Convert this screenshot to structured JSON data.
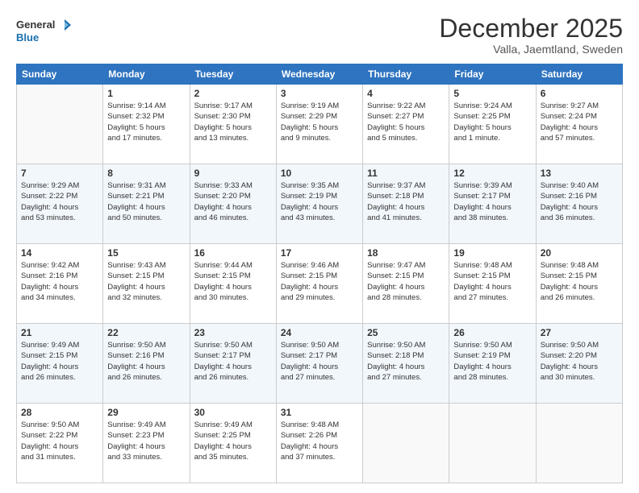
{
  "logo": {
    "line1": "General",
    "line2": "Blue"
  },
  "title": "December 2025",
  "subtitle": "Valla, Jaemtland, Sweden",
  "days_header": [
    "Sunday",
    "Monday",
    "Tuesday",
    "Wednesday",
    "Thursday",
    "Friday",
    "Saturday"
  ],
  "weeks": [
    [
      {
        "num": "",
        "info": ""
      },
      {
        "num": "1",
        "info": "Sunrise: 9:14 AM\nSunset: 2:32 PM\nDaylight: 5 hours\nand 17 minutes."
      },
      {
        "num": "2",
        "info": "Sunrise: 9:17 AM\nSunset: 2:30 PM\nDaylight: 5 hours\nand 13 minutes."
      },
      {
        "num": "3",
        "info": "Sunrise: 9:19 AM\nSunset: 2:29 PM\nDaylight: 5 hours\nand 9 minutes."
      },
      {
        "num": "4",
        "info": "Sunrise: 9:22 AM\nSunset: 2:27 PM\nDaylight: 5 hours\nand 5 minutes."
      },
      {
        "num": "5",
        "info": "Sunrise: 9:24 AM\nSunset: 2:25 PM\nDaylight: 5 hours\nand 1 minute."
      },
      {
        "num": "6",
        "info": "Sunrise: 9:27 AM\nSunset: 2:24 PM\nDaylight: 4 hours\nand 57 minutes."
      }
    ],
    [
      {
        "num": "7",
        "info": "Sunrise: 9:29 AM\nSunset: 2:22 PM\nDaylight: 4 hours\nand 53 minutes."
      },
      {
        "num": "8",
        "info": "Sunrise: 9:31 AM\nSunset: 2:21 PM\nDaylight: 4 hours\nand 50 minutes."
      },
      {
        "num": "9",
        "info": "Sunrise: 9:33 AM\nSunset: 2:20 PM\nDaylight: 4 hours\nand 46 minutes."
      },
      {
        "num": "10",
        "info": "Sunrise: 9:35 AM\nSunset: 2:19 PM\nDaylight: 4 hours\nand 43 minutes."
      },
      {
        "num": "11",
        "info": "Sunrise: 9:37 AM\nSunset: 2:18 PM\nDaylight: 4 hours\nand 41 minutes."
      },
      {
        "num": "12",
        "info": "Sunrise: 9:39 AM\nSunset: 2:17 PM\nDaylight: 4 hours\nand 38 minutes."
      },
      {
        "num": "13",
        "info": "Sunrise: 9:40 AM\nSunset: 2:16 PM\nDaylight: 4 hours\nand 36 minutes."
      }
    ],
    [
      {
        "num": "14",
        "info": "Sunrise: 9:42 AM\nSunset: 2:16 PM\nDaylight: 4 hours\nand 34 minutes."
      },
      {
        "num": "15",
        "info": "Sunrise: 9:43 AM\nSunset: 2:15 PM\nDaylight: 4 hours\nand 32 minutes."
      },
      {
        "num": "16",
        "info": "Sunrise: 9:44 AM\nSunset: 2:15 PM\nDaylight: 4 hours\nand 30 minutes."
      },
      {
        "num": "17",
        "info": "Sunrise: 9:46 AM\nSunset: 2:15 PM\nDaylight: 4 hours\nand 29 minutes."
      },
      {
        "num": "18",
        "info": "Sunrise: 9:47 AM\nSunset: 2:15 PM\nDaylight: 4 hours\nand 28 minutes."
      },
      {
        "num": "19",
        "info": "Sunrise: 9:48 AM\nSunset: 2:15 PM\nDaylight: 4 hours\nand 27 minutes."
      },
      {
        "num": "20",
        "info": "Sunrise: 9:48 AM\nSunset: 2:15 PM\nDaylight: 4 hours\nand 26 minutes."
      }
    ],
    [
      {
        "num": "21",
        "info": "Sunrise: 9:49 AM\nSunset: 2:15 PM\nDaylight: 4 hours\nand 26 minutes."
      },
      {
        "num": "22",
        "info": "Sunrise: 9:50 AM\nSunset: 2:16 PM\nDaylight: 4 hours\nand 26 minutes."
      },
      {
        "num": "23",
        "info": "Sunrise: 9:50 AM\nSunset: 2:17 PM\nDaylight: 4 hours\nand 26 minutes."
      },
      {
        "num": "24",
        "info": "Sunrise: 9:50 AM\nSunset: 2:17 PM\nDaylight: 4 hours\nand 27 minutes."
      },
      {
        "num": "25",
        "info": "Sunrise: 9:50 AM\nSunset: 2:18 PM\nDaylight: 4 hours\nand 27 minutes."
      },
      {
        "num": "26",
        "info": "Sunrise: 9:50 AM\nSunset: 2:19 PM\nDaylight: 4 hours\nand 28 minutes."
      },
      {
        "num": "27",
        "info": "Sunrise: 9:50 AM\nSunset: 2:20 PM\nDaylight: 4 hours\nand 30 minutes."
      }
    ],
    [
      {
        "num": "28",
        "info": "Sunrise: 9:50 AM\nSunset: 2:22 PM\nDaylight: 4 hours\nand 31 minutes."
      },
      {
        "num": "29",
        "info": "Sunrise: 9:49 AM\nSunset: 2:23 PM\nDaylight: 4 hours\nand 33 minutes."
      },
      {
        "num": "30",
        "info": "Sunrise: 9:49 AM\nSunset: 2:25 PM\nDaylight: 4 hours\nand 35 minutes."
      },
      {
        "num": "31",
        "info": "Sunrise: 9:48 AM\nSunset: 2:26 PM\nDaylight: 4 hours\nand 37 minutes."
      },
      {
        "num": "",
        "info": ""
      },
      {
        "num": "",
        "info": ""
      },
      {
        "num": "",
        "info": ""
      }
    ]
  ]
}
